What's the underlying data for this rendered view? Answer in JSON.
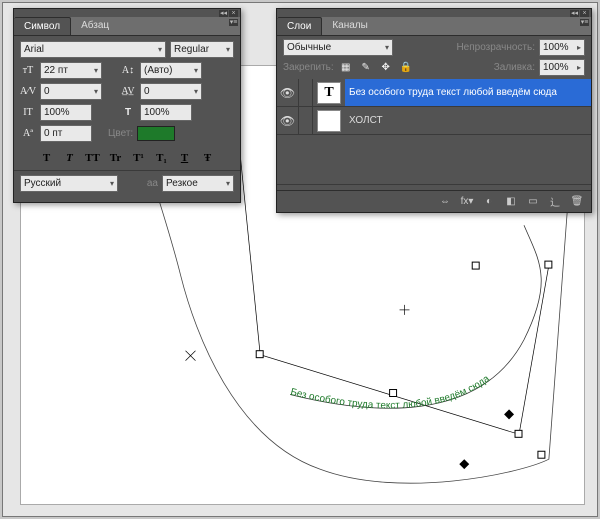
{
  "character_panel": {
    "tabs": {
      "character": "Символ",
      "paragraph": "Абзац"
    },
    "font_family": "Arial",
    "font_style": "Regular",
    "font_size": "22 пт",
    "leading": "(Авто)",
    "kerning": "0",
    "tracking": "0",
    "vscale": "100%",
    "hscale": "100%",
    "baseline": "0 пт",
    "color_label": "Цвет:",
    "color_hex": "#1e7a2a",
    "style_buttons": [
      "T",
      "T",
      "TT",
      "Tr",
      "T¹",
      "T₁",
      "T",
      "Ŧ"
    ],
    "language": "Русский",
    "aa_prefix": "aа",
    "aa_mode": "Резкое"
  },
  "layers_panel": {
    "tabs": {
      "layers": "Слои",
      "channels": "Каналы"
    },
    "blend_mode": "Обычные",
    "opacity_label": "Непрозрачность:",
    "opacity": "100%",
    "lock_label": "Закрепить:",
    "fill_label": "Заливка:",
    "fill": "100%",
    "layers": [
      {
        "visible": "👁",
        "thumb": "T",
        "name": "Без особого труда текст любой введём сюда",
        "selected": true
      },
      {
        "visible": "👁",
        "thumb": "",
        "name": "ХОЛСТ",
        "selected": false
      }
    ],
    "footer_icons": [
      "⇔",
      "fx▾",
      "◐",
      "◧",
      "▭",
      "⻌",
      "🗑"
    ]
  },
  "canvas": {
    "path_text": "Без особого труда текст любой введём сюда"
  }
}
